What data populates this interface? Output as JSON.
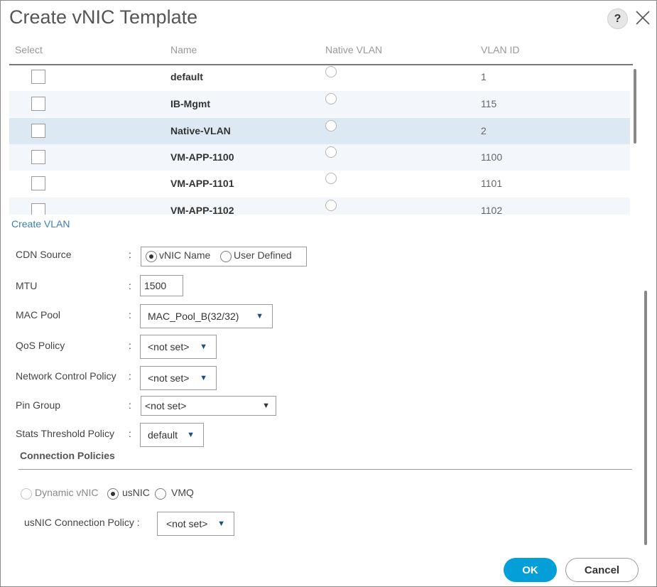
{
  "dialog": {
    "title": "Create vNIC Template",
    "help_label": "?"
  },
  "vlan_table": {
    "columns": [
      "Select",
      "Name",
      "Native VLAN",
      "VLAN ID"
    ],
    "rows": [
      {
        "name": "default",
        "vlan_id": "1"
      },
      {
        "name": "IB-Mgmt",
        "vlan_id": "115"
      },
      {
        "name": "Native-VLAN",
        "vlan_id": "2"
      },
      {
        "name": "VM-APP-1100",
        "vlan_id": "1100"
      },
      {
        "name": "VM-APP-1101",
        "vlan_id": "1101"
      },
      {
        "name": "VM-APP-1102",
        "vlan_id": "1102"
      }
    ]
  },
  "create_vlan_link": "Create VLAN",
  "form": {
    "colon": ":",
    "cdn_source": {
      "label": "CDN Source",
      "option1": "vNIC Name",
      "option2": "User Defined",
      "selected": "vNIC Name"
    },
    "mtu": {
      "label": "MTU",
      "value": "1500"
    },
    "mac_pool": {
      "label": "MAC Pool",
      "value": "MAC_Pool_B(32/32)"
    },
    "qos_policy": {
      "label": "QoS Policy",
      "value": "<not set>"
    },
    "network_control_policy": {
      "label": "Network Control Policy",
      "value": "<not set>"
    },
    "pin_group": {
      "label": "Pin Group",
      "value": "<not set>"
    },
    "stats_threshold_policy": {
      "label": "Stats Threshold Policy",
      "value": "default"
    }
  },
  "connection_policies": {
    "heading": "Connection Policies",
    "options": [
      "Dynamic vNIC",
      "usNIC",
      "VMQ"
    ],
    "selected": "usNIC",
    "usnic_policy": {
      "label": "usNIC Connection Policy :",
      "value": "<not set>"
    }
  },
  "footer": {
    "ok": "OK",
    "cancel": "Cancel"
  },
  "colors": {
    "accent": "#049fd9",
    "link": "#3a7fb5",
    "selected_row": "#dce8f2"
  }
}
